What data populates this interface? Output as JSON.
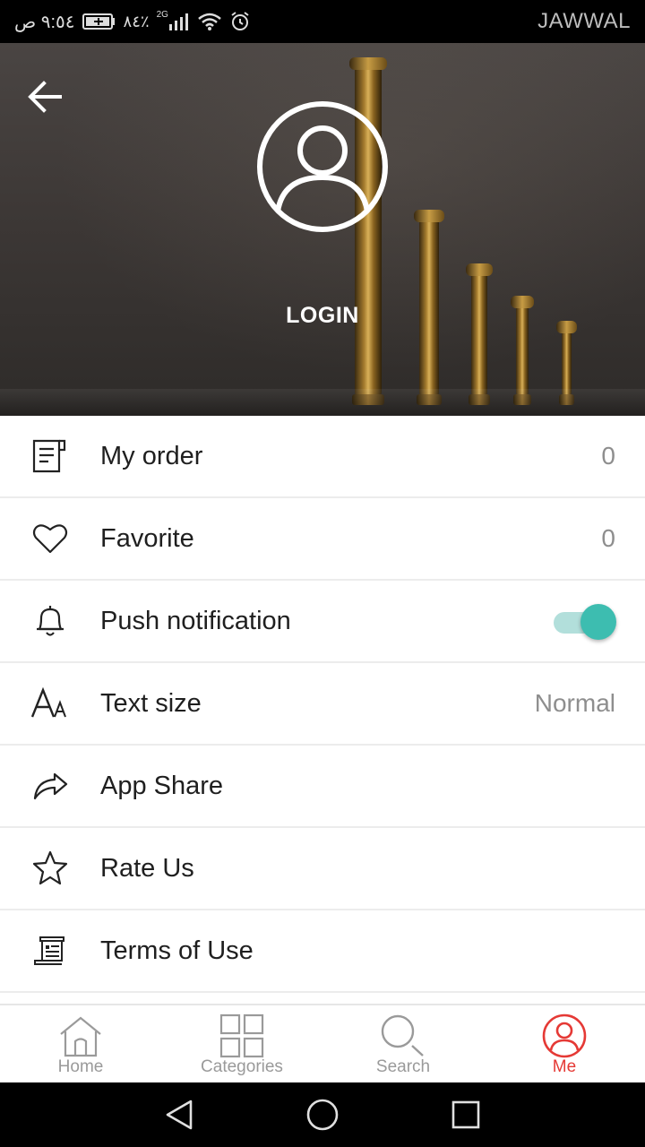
{
  "status_bar": {
    "time": "٩:٥٤ ص",
    "battery": "٨٤٪",
    "network": "2G",
    "carrier": "JAWWAL"
  },
  "header": {
    "login_label": "LOGIN"
  },
  "menu": {
    "items": [
      {
        "label": "My order",
        "value": "0",
        "icon": "order-icon"
      },
      {
        "label": "Favorite",
        "value": "0",
        "icon": "heart-icon"
      },
      {
        "label": "Push notification",
        "toggle_on": true,
        "icon": "bell-icon"
      },
      {
        "label": "Text size",
        "value": "Normal",
        "icon": "text-size-icon"
      },
      {
        "label": "App Share",
        "icon": "share-icon"
      },
      {
        "label": "Rate Us",
        "icon": "star-icon"
      },
      {
        "label": "Terms of Use",
        "icon": "terms-icon"
      }
    ]
  },
  "bottom_nav": {
    "items": [
      {
        "label": "Home",
        "icon": "home-icon"
      },
      {
        "label": "Categories",
        "icon": "grid-icon"
      },
      {
        "label": "Search",
        "icon": "search-icon"
      },
      {
        "label": "Me",
        "icon": "user-icon",
        "active": true
      }
    ],
    "active_color": "#e53935",
    "inactive_color": "#9a9a9a"
  },
  "colors": {
    "toggle_thumb": "#3dbdb0",
    "toggle_track": "#b2dfdb"
  }
}
